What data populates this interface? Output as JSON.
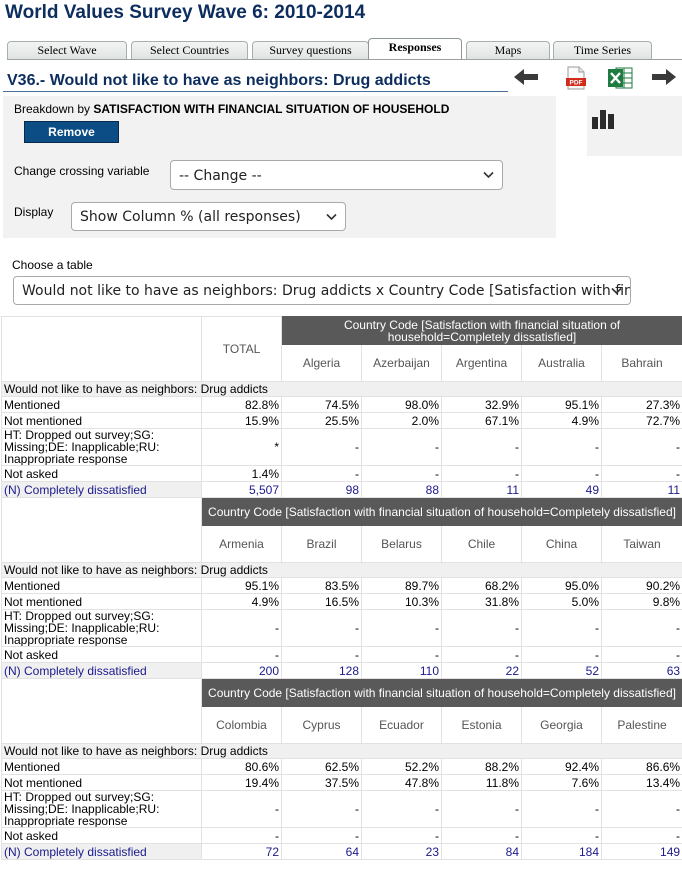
{
  "site_title": "World Values Survey Wave 6: 2010-2014",
  "tabs": [
    "Select Wave",
    "Select Countries",
    "Survey questions",
    "Responses",
    "Maps",
    "Time Series"
  ],
  "active_tab": "Responses",
  "variable_title": "V36.- Would not like to have as neighbors: Drug addicts",
  "icons": [
    "back-arrow-icon",
    "pdf-icon",
    "excel-icon",
    "forward-arrow-icon",
    "bar-chart-icon"
  ],
  "breakdown": {
    "prefix": "Breakdown by",
    "variable": "SATISFACTION WITH FINANCIAL SITUATION OF HOUSEHOLD"
  },
  "remove_label": "Remove",
  "crossing": {
    "label": "Change crossing variable",
    "value": "-- Change --"
  },
  "display": {
    "label": "Display",
    "value": "Show Column % (all responses)"
  },
  "table_choice": {
    "label": "Choose a table",
    "value": "Would not like to have as neighbors: Drug addicts x Country Code [Satisfaction with fin"
  },
  "total_label": "TOTAL",
  "group_header": "Country Code [Satisfaction with financial situation of household=Completely dissatisfied]",
  "question_label": "Would not like to have as neighbors: Drug addicts",
  "row_labels": [
    "Mentioned",
    "Not mentioned",
    "HT: Dropped out survey;SG: Missing;DE: Inapplicable;RU: Inappropriate response",
    "Not asked",
    "(N) Completely dissatisfied"
  ],
  "blocks": [
    {
      "countries": [
        "Algeria",
        "Azerbaijan",
        "Argentina",
        "Australia",
        "Bahrain"
      ],
      "total": [
        "82.8%",
        "15.9%",
        "*",
        "1.4%",
        "5,507"
      ],
      "values": [
        [
          "74.5%",
          "98.0%",
          "32.9%",
          "95.1%",
          "27.3%"
        ],
        [
          "25.5%",
          "2.0%",
          "67.1%",
          "4.9%",
          "72.7%"
        ],
        [
          "-",
          "-",
          "-",
          "-",
          "-"
        ],
        [
          "-",
          "-",
          "-",
          "-",
          "-"
        ],
        [
          "98",
          "88",
          "11",
          "49",
          "11"
        ]
      ]
    },
    {
      "countries": [
        "Armenia",
        "Brazil",
        "Belarus",
        "Chile",
        "China",
        "Taiwan"
      ],
      "values": [
        [
          "95.1%",
          "83.5%",
          "89.7%",
          "68.2%",
          "95.0%",
          "90.2%"
        ],
        [
          "4.9%",
          "16.5%",
          "10.3%",
          "31.8%",
          "5.0%",
          "9.8%"
        ],
        [
          "-",
          "-",
          "-",
          "-",
          "-",
          "-"
        ],
        [
          "-",
          "-",
          "-",
          "-",
          "-",
          "-"
        ],
        [
          "200",
          "128",
          "110",
          "22",
          "52",
          "63"
        ]
      ]
    },
    {
      "countries": [
        "Colombia",
        "Cyprus",
        "Ecuador",
        "Estonia",
        "Georgia",
        "Palestine"
      ],
      "values": [
        [
          "80.6%",
          "62.5%",
          "52.2%",
          "88.2%",
          "92.4%",
          "86.6%"
        ],
        [
          "19.4%",
          "37.5%",
          "47.8%",
          "11.8%",
          "7.6%",
          "13.4%"
        ],
        [
          "-",
          "-",
          "-",
          "-",
          "-",
          "-"
        ],
        [
          "-",
          "-",
          "-",
          "-",
          "-",
          "-"
        ],
        [
          "72",
          "64",
          "23",
          "84",
          "184",
          "149"
        ]
      ]
    }
  ]
}
